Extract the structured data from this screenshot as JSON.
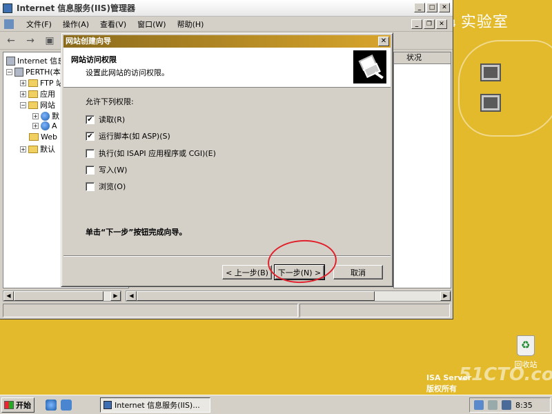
{
  "desktop": {
    "heading": "实验室",
    "recycle_bin_label": "回收站",
    "watermark_line1": "ISA Server",
    "watermark_line2": "版权所有",
    "watermark_logo": "51CTO.com"
  },
  "iis": {
    "title": "Internet 信息服务(IIS)管理器",
    "menu": [
      "文件(F)",
      "操作(A)",
      "查看(V)",
      "窗口(W)",
      "帮助(H)"
    ],
    "tree": {
      "root": "Internet 信息",
      "server": "PERTH(本",
      "ftp": "FTP 站",
      "apps": "应用",
      "websites": "网站",
      "site1": "默",
      "site2": "A",
      "web": "Web",
      "default": "默认"
    },
    "list_header_status": "状况"
  },
  "wizard": {
    "title": "网站创建向导",
    "header_title": "网站访问权限",
    "header_subtitle": "设置此网站的访问权限。",
    "permissions_label": "允许下列权限:",
    "options": [
      {
        "label": "读取(R)",
        "checked": true
      },
      {
        "label": "运行脚本(如 ASP)(S)",
        "checked": true
      },
      {
        "label": "执行(如 ISAPI 应用程序或 CGI)(E)",
        "checked": false
      },
      {
        "label": "写入(W)",
        "checked": false
      },
      {
        "label": "浏览(O)",
        "checked": false
      }
    ],
    "finish_text": "单击“下一步”按钮完成向导。",
    "back_label": "< 上一步(B)",
    "next_label": "下一步(N) >",
    "cancel_label": "取消",
    "check_glyph": "✔"
  },
  "taskbar": {
    "start_label": "开始",
    "task_label": "Internet 信息服务(IIS)...",
    "clock": "8:35"
  }
}
